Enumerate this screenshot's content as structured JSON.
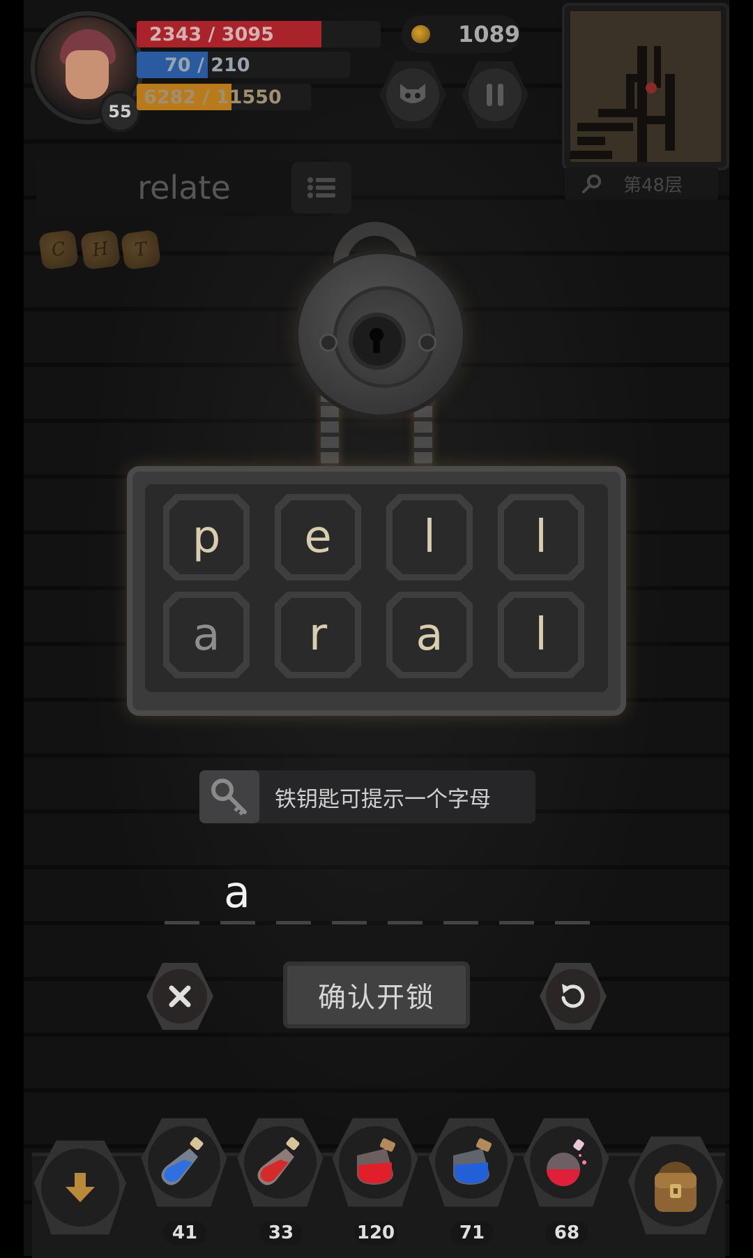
{
  "player": {
    "level": "55",
    "hp": "2343 / 3095",
    "hp_fraction": 0.757,
    "mp": "70 / 210",
    "mp_fraction": 0.333,
    "xp": "6282 / 11550",
    "xp_fraction": 0.544
  },
  "gold": "1089",
  "floor": "第48层",
  "word": "relate",
  "runes": [
    "C",
    "H",
    "T"
  ],
  "puzzle": {
    "rows": [
      [
        {
          "letter": "p",
          "dim": false
        },
        {
          "letter": "e",
          "dim": false
        },
        {
          "letter": "l",
          "dim": false
        },
        {
          "letter": "l",
          "dim": false
        }
      ],
      [
        {
          "letter": "a",
          "dim": true
        },
        {
          "letter": "r",
          "dim": false
        },
        {
          "letter": "a",
          "dim": false
        },
        {
          "letter": "l",
          "dim": false
        }
      ]
    ]
  },
  "hint_text": "铁钥匙可提示一个字母",
  "answer": {
    "typed": "a",
    "slots": 8
  },
  "buttons": {
    "confirm_label": "确认开锁"
  },
  "inventory": [
    {
      "name": "blue-flask-icon",
      "count": "41"
    },
    {
      "name": "red-flask-icon",
      "count": "33"
    },
    {
      "name": "red-jar-icon",
      "count": "120"
    },
    {
      "name": "blue-jar-icon",
      "count": "71"
    },
    {
      "name": "red-round-potion-icon",
      "count": "68"
    }
  ],
  "colors": {
    "hp": "#a8232a",
    "mp": "#2a5aa0",
    "xp": "#b87a1a",
    "tile_text": "#d9cdb0",
    "background": "#111111"
  }
}
